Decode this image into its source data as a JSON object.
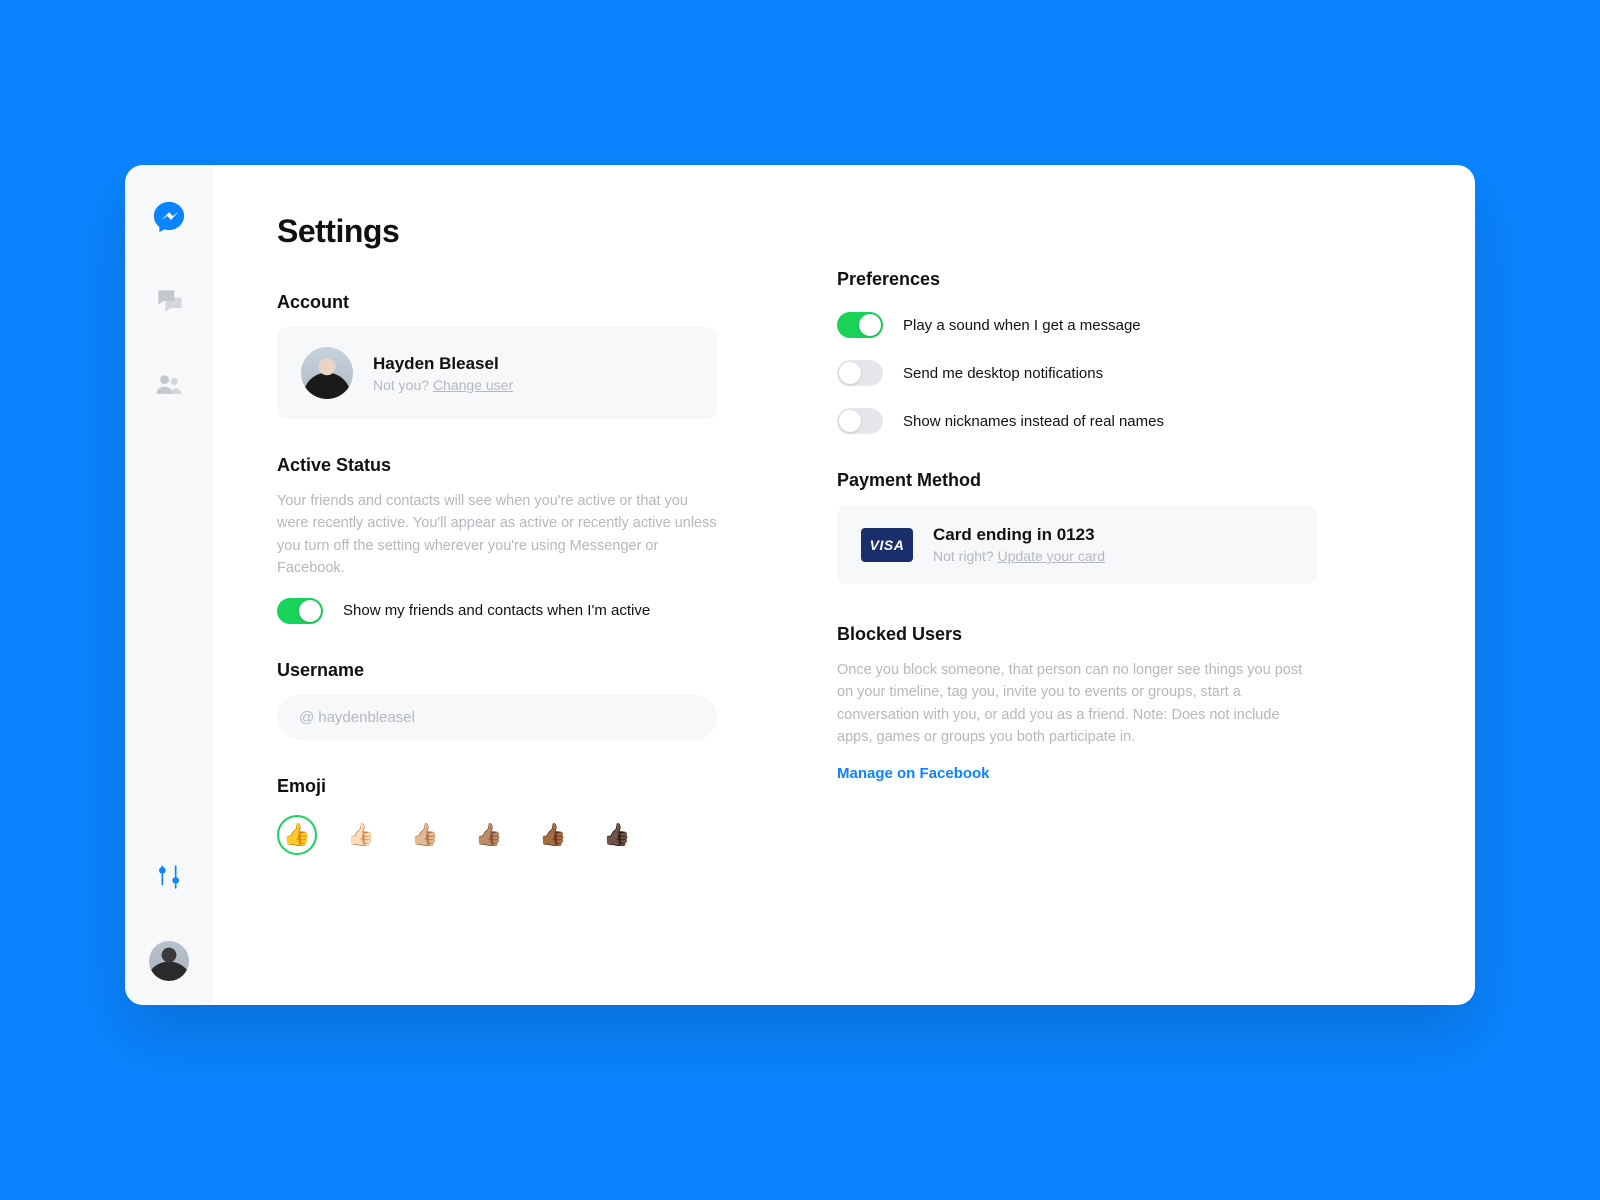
{
  "page": {
    "title": "Settings"
  },
  "account": {
    "heading": "Account",
    "name": "Hayden Bleasel",
    "not_you": "Not you? ",
    "change_user": "Change user"
  },
  "active_status": {
    "heading": "Active Status",
    "description": "Your friends and contacts will see when you're active or that you were recently active. You'll appear as active or recently active unless you turn off the setting wherever you're using Messenger or Facebook.",
    "toggle_label": "Show my friends and contacts when I'm active"
  },
  "username": {
    "heading": "Username",
    "prefix": "@",
    "value": "haydenbleasel"
  },
  "emoji": {
    "heading": "Emoji",
    "options": [
      "👍",
      "👍🏻",
      "👍🏼",
      "👍🏽",
      "👍🏾",
      "👍🏿"
    ],
    "selected_index": 0
  },
  "preferences": {
    "heading": "Preferences",
    "items": [
      {
        "label": "Play a sound when I get a message",
        "on": true
      },
      {
        "label": "Send me desktop notifications",
        "on": false
      },
      {
        "label": "Show nicknames instead of real names",
        "on": false
      }
    ]
  },
  "payment": {
    "heading": "Payment Method",
    "badge": "VISA",
    "card_title": "Card ending in 0123",
    "not_right": "Not right? ",
    "update": "Update your card"
  },
  "blocked": {
    "heading": "Blocked Users",
    "description": "Once you block someone, that person can no longer see things you post on your timeline, tag you, invite you to events or groups, start a conversation with you, or add you as a friend. Note: Does not include apps, games or groups you both participate in.",
    "link": "Manage on Facebook"
  }
}
